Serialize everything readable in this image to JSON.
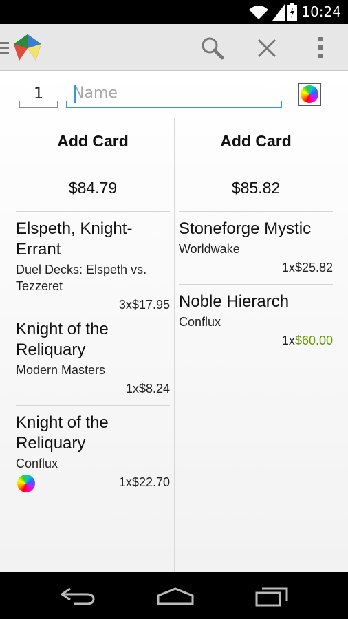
{
  "status_bar": {
    "time": "10:24"
  },
  "toolbar": {
    "menu_icon": "hamburger-icon",
    "logo_icon": "app-logo-icon",
    "search_icon": "search-icon",
    "close_icon": "close-icon",
    "overflow_icon": "overflow-menu-icon"
  },
  "entry": {
    "quantity": "1",
    "name_placeholder": "Name",
    "color_icon": "rainbow-icon"
  },
  "left_column": {
    "add_label": "Add Card",
    "total": "$84.79",
    "cards": [
      {
        "name": "Elspeth, Knight-Errant",
        "set": "Duel Decks: Elspeth vs. Tezzeret",
        "qty": "3x",
        "price": "$17.95",
        "foil": false
      },
      {
        "name": "Knight of the Reliquary",
        "set": "Modern Masters",
        "qty": "1x",
        "price": "$8.24",
        "foil": false
      },
      {
        "name": "Knight of the Reliquary",
        "set": "Conflux",
        "qty": "1x",
        "price": "$22.70",
        "foil": false,
        "has_rainbow": true
      }
    ]
  },
  "right_column": {
    "add_label": "Add Card",
    "total": "$85.82",
    "cards": [
      {
        "name": "Stoneforge Mystic",
        "set": "Worldwake",
        "qty": "1x",
        "price": "$25.82",
        "foil": false
      },
      {
        "name": "Noble Hierarch",
        "set": "Conflux",
        "qty": "1x",
        "price": "$60.00",
        "foil": true
      }
    ]
  },
  "nav_bar": {
    "back_icon": "back-icon",
    "home_icon": "home-icon",
    "recents_icon": "recents-icon"
  },
  "colors": {
    "accent": "#2f9bd2",
    "foil_price": "#669900"
  }
}
